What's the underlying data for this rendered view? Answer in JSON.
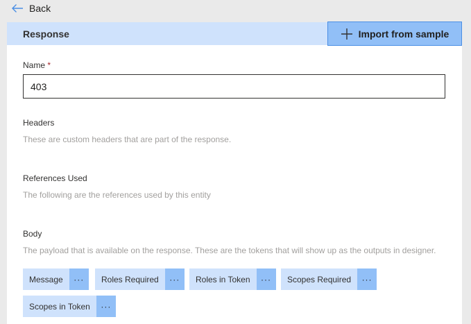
{
  "nav": {
    "back_label": "Back"
  },
  "header": {
    "title": "Response",
    "import_label": "Import from sample"
  },
  "name_field": {
    "label": "Name",
    "required_mark": "*",
    "value": "403"
  },
  "headers_section": {
    "title": "Headers",
    "description": "These are custom headers that are part of the response."
  },
  "references_section": {
    "title": "References Used",
    "description": "The following are the references used by this entity"
  },
  "body_section": {
    "title": "Body",
    "description": "The payload that is available on the response. These are the tokens that will show up as the outputs in designer.",
    "tokens": [
      {
        "label": "Message",
        "more": "···"
      },
      {
        "label": "Roles Required",
        "more": "···"
      },
      {
        "label": "Roles in Token",
        "more": "···"
      },
      {
        "label": "Scopes Required",
        "more": "···"
      },
      {
        "label": "Scopes in Token",
        "more": "···"
      }
    ]
  },
  "colors": {
    "header_bg": "#cfe2fc",
    "button_bg": "#91bff7",
    "accent": "#4a8ee4",
    "required": "#a4262c"
  },
  "icons": {
    "back": "arrow-left-icon",
    "import": "plus-icon"
  }
}
